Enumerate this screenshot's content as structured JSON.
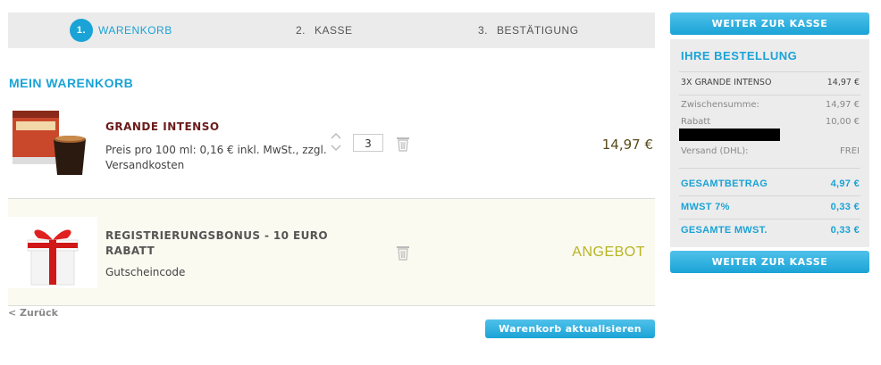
{
  "steps": [
    {
      "num": "1.",
      "label": "WARENKORB"
    },
    {
      "num": "2.",
      "label": "KASSE"
    },
    {
      "num": "3.",
      "label": "BESTÄTIGUNG"
    }
  ],
  "cart": {
    "title": "MEIN WARENKORB",
    "items": [
      {
        "name": "GRANDE INTENSO",
        "description": "Preis pro 100 ml: 0,16 € inkl. MwSt., zzgl. Versandkosten",
        "quantity": "3",
        "price": "14,97 €"
      },
      {
        "name": "REGISTRIERUNGSBONUS - 10 EURO RABATT",
        "description": "Gutscheincode",
        "price": "ANGEBOT"
      }
    ],
    "back_link": "< Zurück",
    "update_button": "Warenkorb aktualisieren"
  },
  "sidebar": {
    "checkout_button": "WEITER ZUR KASSE",
    "order_title": "IHRE BESTELLUNG",
    "order_item": {
      "label": "3X GRANDE INTENSO",
      "value": "14,97 €"
    },
    "lines": [
      {
        "label": "Zwischensumme:",
        "value": "14,97 €"
      },
      {
        "label": "Rabatt",
        "value": "10,00 €"
      },
      {
        "label": "Versand (DHL):",
        "value": "FREI"
      }
    ],
    "totals": [
      {
        "label": "GESAMTBETRAG",
        "value": "4,97 €"
      },
      {
        "label": "MWST 7%",
        "value": "0,33 €"
      },
      {
        "label": "GESAMTE MWST.",
        "value": "0,33 €"
      }
    ]
  },
  "colors": {
    "accent": "#1aa3d6",
    "product_name": "#6b1b1b",
    "offer": "#b8b425",
    "steps_bg": "#ebebeb",
    "order_bg": "#ececec"
  },
  "icons": [
    "trash-icon",
    "stepper-icon",
    "coffee-pack-image",
    "gift-image"
  ]
}
